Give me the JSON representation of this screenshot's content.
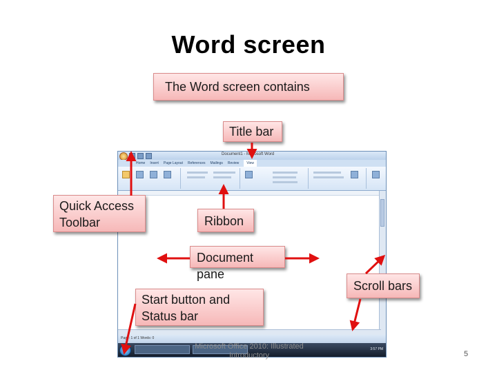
{
  "slide": {
    "title": "Word screen",
    "page_number": "5",
    "footer_line1": "Microsoft Office 2010: Illustrated",
    "footer_line2": "Introductory"
  },
  "callouts": {
    "intro": "The Word screen contains",
    "title_bar": "Title bar",
    "quick_access_line1": "Quick Access",
    "quick_access_line2": "Toolbar",
    "ribbon": "Ribbon",
    "document_pane": "Document pane",
    "scroll_bars": "Scroll bars",
    "start_status_line1": "Start button and",
    "start_status_line2": "Status bar"
  },
  "screenshot": {
    "window_title": "Document1 - Microsoft Word",
    "tabs": [
      "Home",
      "Insert",
      "Page Layout",
      "References",
      "Mailings",
      "Review",
      "View"
    ],
    "active_tab": "View",
    "status_text": "Page: 1 of 1   Words: 0",
    "clock": "3:57 PM"
  },
  "colors": {
    "arrow": "#e01010",
    "callout_fill": "#f6b8b8",
    "callout_border": "#d98a8a"
  }
}
